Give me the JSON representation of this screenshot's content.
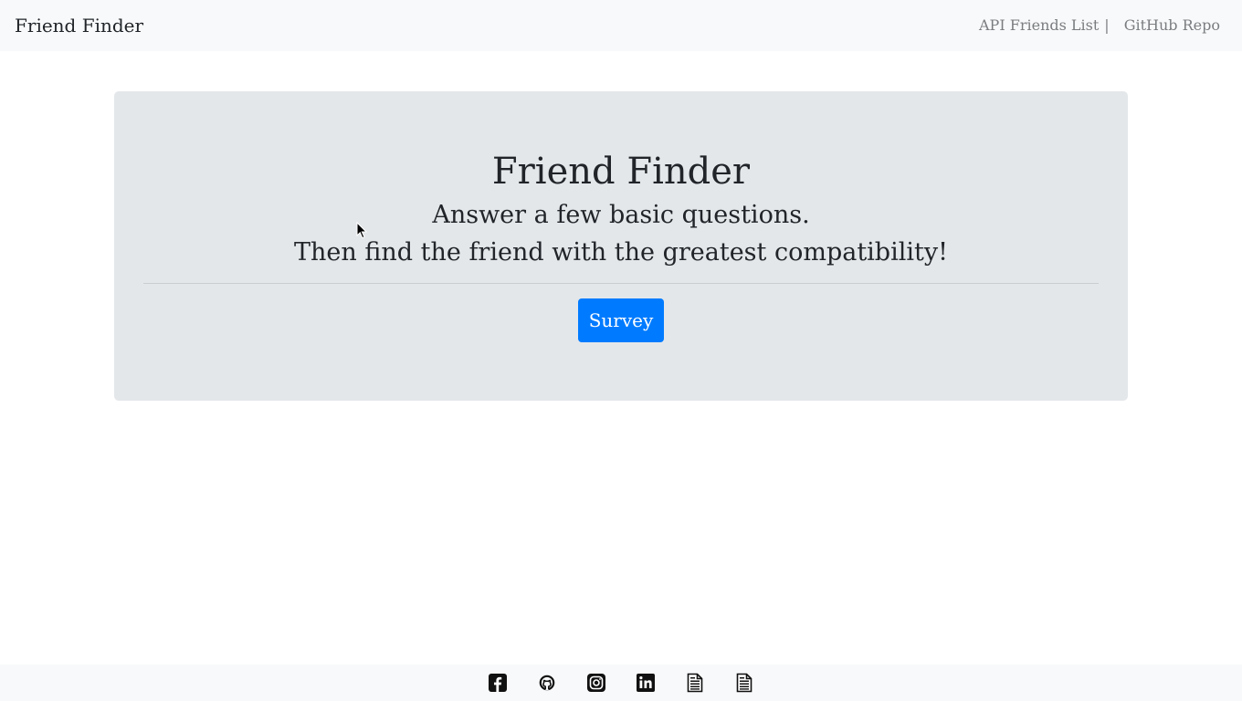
{
  "navbar": {
    "brand": "Friend Finder",
    "links": [
      {
        "label": "API Friends List",
        "separator": "|"
      },
      {
        "label": "GitHub Repo"
      }
    ]
  },
  "jumbotron": {
    "title": "Friend Finder",
    "line1": "Answer a few basic questions.",
    "line2": "Then find the friend with the greatest compatibility!",
    "button_label": "Survey"
  },
  "footer": {
    "icons": [
      "facebook-icon",
      "github-icon",
      "instagram-icon",
      "linkedin-icon",
      "document-icon",
      "document-icon"
    ]
  },
  "colors": {
    "navbar_bg": "#f8f9fa",
    "jumbotron_bg": "#e4e7ea",
    "button_bg": "#007bff",
    "text": "#212529",
    "nav_link": "#7a7d80"
  }
}
